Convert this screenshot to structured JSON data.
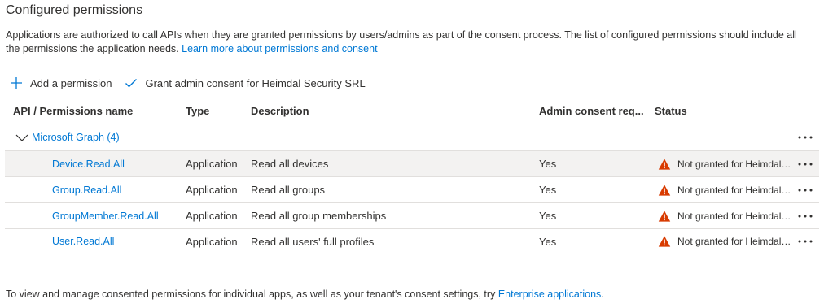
{
  "section": {
    "title": "Configured permissions",
    "description": "Applications are authorized to call APIs when they are granted permissions by users/admins as part of the consent process. The list of configured permissions should include all the permissions the application needs.",
    "learn_more": "Learn more about permissions and consent"
  },
  "toolbar": {
    "add_permission": "Add a permission",
    "grant_consent": "Grant admin consent for Heimdal Security SRL"
  },
  "table": {
    "columns": {
      "api": "API / Permissions name",
      "type": "Type",
      "description": "Description",
      "admin": "Admin consent req...",
      "status": "Status"
    },
    "group": {
      "label": "Microsoft Graph (4)"
    },
    "rows": [
      {
        "name": "Device.Read.All",
        "type": "Application",
        "description": "Read all devices",
        "admin": "Yes",
        "status": "Not granted for Heimdal Security SRL"
      },
      {
        "name": "Group.Read.All",
        "type": "Application",
        "description": "Read all groups",
        "admin": "Yes",
        "status": "Not granted for Heimdal Security SRL"
      },
      {
        "name": "GroupMember.Read.All",
        "type": "Application",
        "description": "Read all group memberships",
        "admin": "Yes",
        "status": "Not granted for Heimdal Security SRL"
      },
      {
        "name": "User.Read.All",
        "type": "Application",
        "description": "Read all users' full profiles",
        "admin": "Yes",
        "status": "Not granted for Heimdal Security SRL"
      }
    ]
  },
  "footer": {
    "text": "To view and manage consented permissions for individual apps, as well as your tenant's consent settings, try",
    "link": "Enterprise applications",
    "end": "."
  },
  "colors": {
    "accent": "#0078d4",
    "warning": "#d83b01",
    "selected_row": "#f3f2f1",
    "border": "#e1dfdd"
  },
  "icons": {
    "add": "plus-icon",
    "grant": "checkmark-icon",
    "expand": "chevron-down-icon",
    "warning": "warning-icon",
    "more": "more-icon"
  }
}
